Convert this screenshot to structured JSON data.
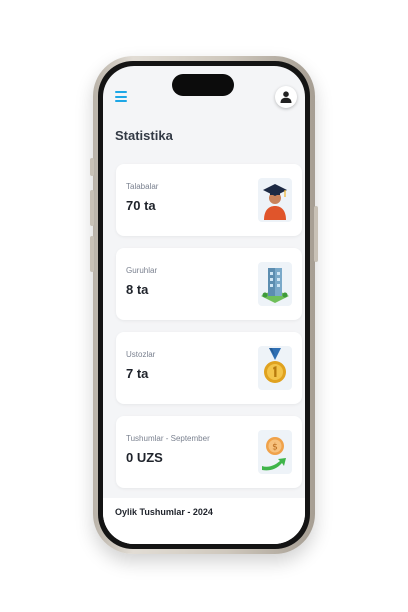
{
  "header": {
    "menu_icon": "hamburger-menu-icon",
    "profile_icon": "user-icon",
    "accent": "#1ea7e6"
  },
  "page": {
    "title": "Statistika"
  },
  "stats": [
    {
      "label": "Talabalar",
      "value": "70 ta",
      "icon": "graduate-icon"
    },
    {
      "label": "Guruhlar",
      "value": "8 ta",
      "icon": "building-icon"
    },
    {
      "label": "Ustozlar",
      "value": "7 ta",
      "icon": "medal-icon"
    },
    {
      "label": "Tushumlar - September",
      "value": "0 UZS",
      "icon": "income-coin-icon"
    }
  ],
  "monthly": {
    "title": "Oylik Tushumlar - 2024"
  }
}
